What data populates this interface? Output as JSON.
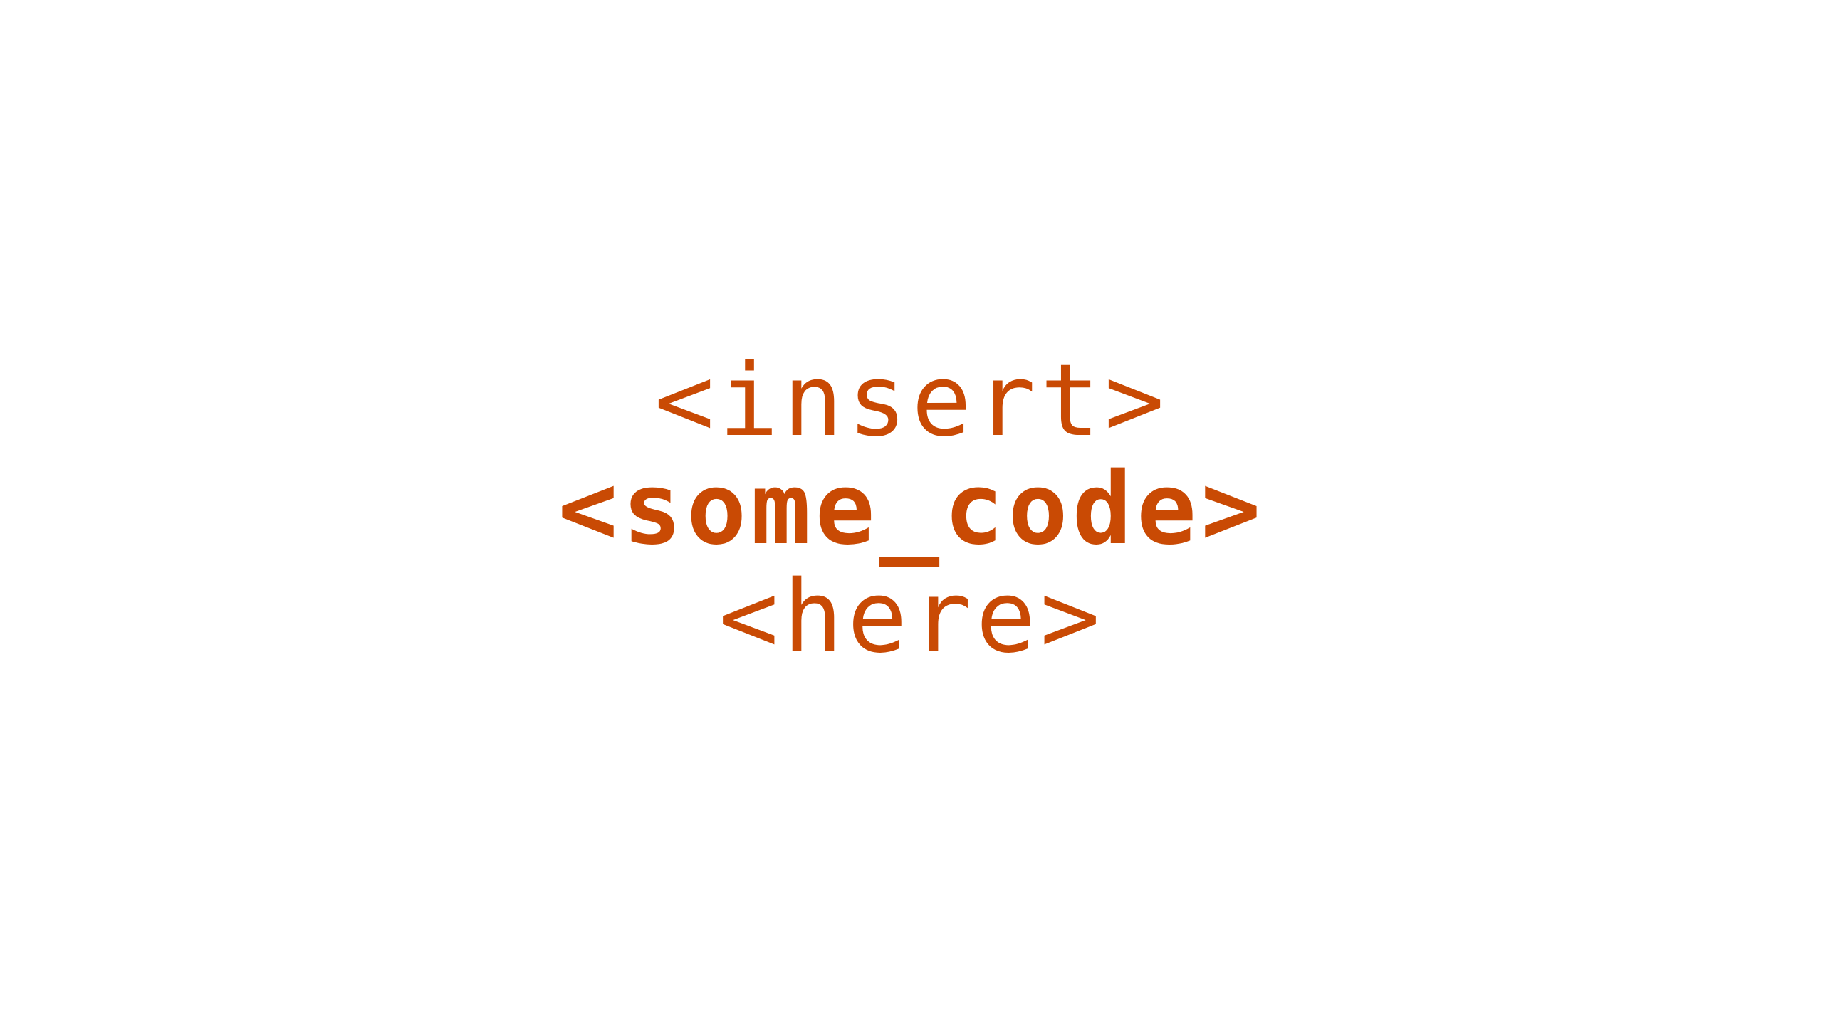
{
  "colors": {
    "background": "#ffffff",
    "text": "#c94a04"
  },
  "lines": [
    {
      "text": "<insert>",
      "weight": "regular"
    },
    {
      "text": "<some_code>",
      "weight": "bold"
    },
    {
      "text": "<here>",
      "weight": "regular"
    }
  ]
}
